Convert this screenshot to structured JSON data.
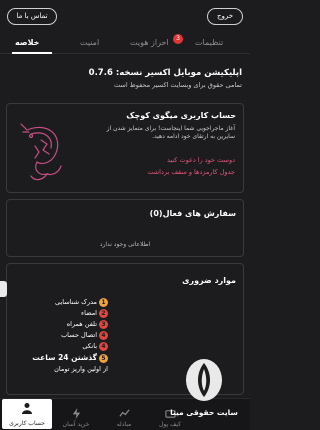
{
  "top_bar": {
    "contact_label": "تماس با ما",
    "exit_label": "خروج"
  },
  "tabs": [
    {
      "label": "خلاصه"
    },
    {
      "label": "امنیت"
    },
    {
      "label": "احراز هویت",
      "badge": "3"
    },
    {
      "label": "تنظیمات"
    }
  ],
  "summary": {
    "version": "اپلیکیشن موبایل اکسیر نسخه: 0.7.6",
    "copyright": "تمامی حقوق برای وبسایت اکسیر محفوظ است"
  },
  "account_card": {
    "title": "حساب کاربری میگوی کوچک",
    "description": "آغاز ماجراجویی شما اینجاست! برای متمایز شدن از سایرین به ارتقای خود ادامه دهید.",
    "invite_link": "دوست خود را دعوت کنید",
    "fees_link": "جدول کارمزدها و سقف برداشت"
  },
  "orders_card": {
    "title": "سفارش های فعال(0)",
    "empty_text": "اطلاعاتی وجود ندارد"
  },
  "required_card": {
    "title": "موارد ضروری",
    "items": [
      {
        "num": "1",
        "text": "مدرک شناسایی",
        "color": "#f0a03c"
      },
      {
        "num": "2",
        "text": "امضاء",
        "color": "#e2473f"
      },
      {
        "num": "3",
        "text": "تلفن همراه",
        "color": "#e2473f"
      },
      {
        "num": "4",
        "text": "اتصال حساب",
        "color": "#e2473f"
      },
      {
        "num": "4",
        "text": "بانکی",
        "color": "#e2473f"
      },
      {
        "num": "5",
        "text": "گذشتن 24 ساعت",
        "color": "#f0a03c"
      },
      {
        "num": "",
        "text": "از اولین واریز تومان",
        "color": ""
      }
    ]
  },
  "bottom_nav": [
    {
      "label": "حساب کاربری",
      "icon": "user-icon",
      "active": true
    },
    {
      "label": "خرید آسان",
      "icon": "lightning-icon"
    },
    {
      "label": "مبادله",
      "icon": "chart-icon"
    },
    {
      "label": "کیف پول",
      "icon": "wallet-icon"
    }
  ],
  "watermark": {
    "text": "سایت حقوقی مینا"
  }
}
